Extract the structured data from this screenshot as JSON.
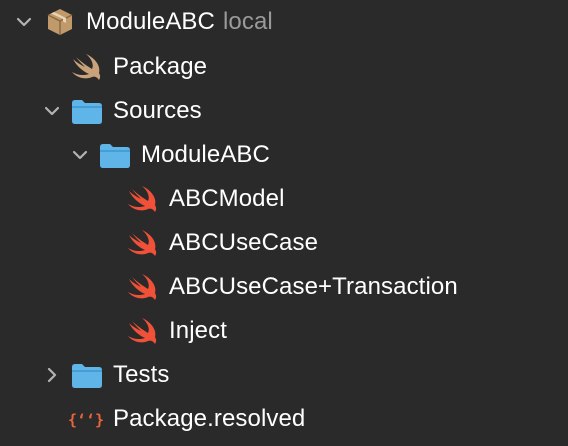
{
  "tree": {
    "package_root": {
      "name": "ModuleABC",
      "location_badge": "local",
      "icon": "package-box-icon",
      "expanded": true
    },
    "package_manifest": {
      "name": "Package",
      "icon": "swift-icon"
    },
    "sources_folder": {
      "name": "Sources",
      "icon": "folder-icon",
      "expanded": true
    },
    "module_folder": {
      "name": "ModuleABC",
      "icon": "folder-icon",
      "expanded": true
    },
    "files": [
      {
        "name": "ABCModel",
        "icon": "swift-icon"
      },
      {
        "name": "ABCUseCase",
        "icon": "swift-icon"
      },
      {
        "name": "ABCUseCase+Transaction",
        "icon": "swift-icon"
      },
      {
        "name": "Inject",
        "icon": "swift-icon"
      }
    ],
    "tests_folder": {
      "name": "Tests",
      "icon": "folder-icon",
      "expanded": false
    },
    "resolved_file": {
      "name": "Package.resolved",
      "icon": "json-braces-icon"
    }
  },
  "colors": {
    "background": "#2a2a2a",
    "text": "#ffffff",
    "secondary_text": "#9a9a9a",
    "chevron": "#b3b3b3",
    "folder_blue": "#5fb4e8",
    "swift_orange": "#f05138",
    "swift_tan": "#c9a27a",
    "package_brown": "#c19a6b",
    "json_red": "#e8643c"
  }
}
